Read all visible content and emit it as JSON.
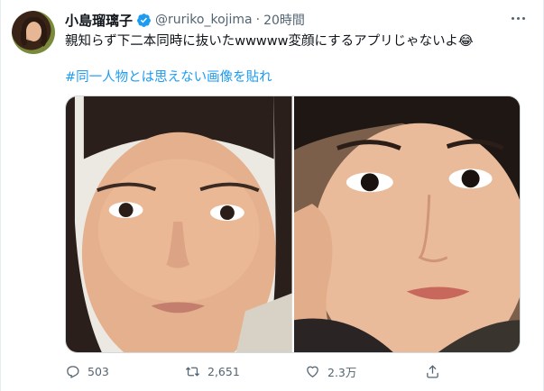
{
  "tweet": {
    "display_name": "小島瑠璃子",
    "handle": "@ruriko_kojima",
    "separator": "·",
    "time": "20時間",
    "text": "親知らず下二本同時に抜いたwwwww変顔にするアプリじゃないよ😂",
    "hashtag": "#同一人物とは思えない画像を貼れ",
    "accent_color": "#1d9bf0",
    "verified_icon": "verified-badge-icon",
    "more_icon": "more-icon"
  },
  "media": {
    "photos": [
      {
        "name": "photo-left",
        "kind": "face-without-makeup"
      },
      {
        "name": "photo-right",
        "kind": "face-with-makeup"
      }
    ]
  },
  "actions": {
    "reply": {
      "icon": "reply-icon",
      "count": "503"
    },
    "retweet": {
      "icon": "retweet-icon",
      "count": "2,651"
    },
    "like": {
      "icon": "heart-icon",
      "count": "2.3万"
    },
    "share": {
      "icon": "share-icon"
    }
  }
}
